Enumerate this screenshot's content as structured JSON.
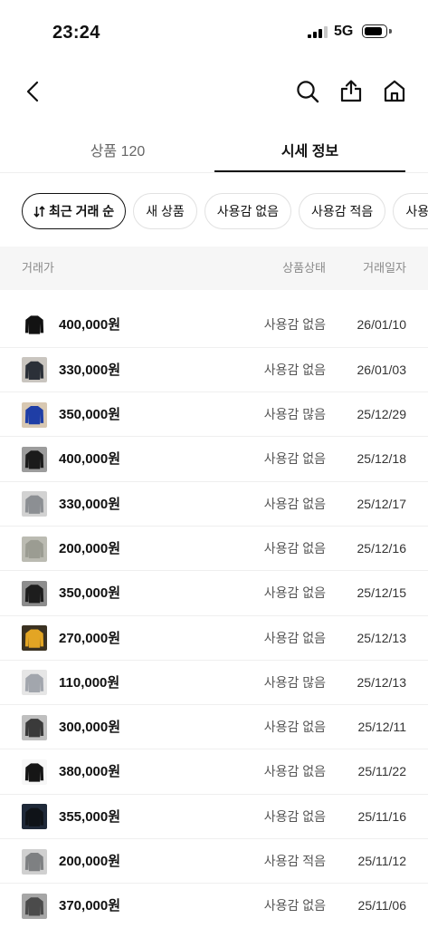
{
  "status_bar": {
    "time": "23:24",
    "network": "5G",
    "signal": {
      "filled": 3,
      "total": 4
    },
    "battery_percent": 85
  },
  "nav": {
    "back_icon": "chevron-left-icon",
    "search_icon": "search-icon",
    "share_icon": "share-icon",
    "home_icon": "home-icon"
  },
  "tabs": [
    {
      "label": "상품 120",
      "active": false
    },
    {
      "label": "시세 정보",
      "active": true
    }
  ],
  "filters": [
    {
      "label": "최근 거래 순",
      "icon": "sort-icon",
      "active": true
    },
    {
      "label": "새 상품",
      "active": false
    },
    {
      "label": "사용감 없음",
      "active": false
    },
    {
      "label": "사용감 적음",
      "active": false
    },
    {
      "label": "사용감",
      "active": false
    }
  ],
  "table": {
    "headers": {
      "price": "거래가",
      "condition": "상품상태",
      "date": "거래일자"
    },
    "rows": [
      {
        "price": "400,000원",
        "condition": "사용감 없음",
        "date": "26/01/10",
        "thumb": {
          "bg": "#ffffff",
          "item": "#121212"
        }
      },
      {
        "price": "330,000원",
        "condition": "사용감 없음",
        "date": "26/01/03",
        "thumb": {
          "bg": "#c9c5bf",
          "item": "#2b3038"
        }
      },
      {
        "price": "350,000원",
        "condition": "사용감 많음",
        "date": "25/12/29",
        "thumb": {
          "bg": "#d8c8b2",
          "item": "#1f3ea6"
        }
      },
      {
        "price": "400,000원",
        "condition": "사용감 없음",
        "date": "25/12/18",
        "thumb": {
          "bg": "#9c9c9c",
          "item": "#1b1b1b"
        }
      },
      {
        "price": "330,000원",
        "condition": "사용감 없음",
        "date": "25/12/17",
        "thumb": {
          "bg": "#d2d2d2",
          "item": "#8c8f93"
        }
      },
      {
        "price": "200,000원",
        "condition": "사용감 없음",
        "date": "25/12/16",
        "thumb": {
          "bg": "#bbbbb2",
          "item": "#9b9c92"
        }
      },
      {
        "price": "350,000원",
        "condition": "사용감 없음",
        "date": "25/12/15",
        "thumb": {
          "bg": "#8d8d8d",
          "item": "#1d1d1d"
        }
      },
      {
        "price": "270,000원",
        "condition": "사용감 없음",
        "date": "25/12/13",
        "thumb": {
          "bg": "#3b3222",
          "item": "#e3a524"
        }
      },
      {
        "price": "110,000원",
        "condition": "사용감 많음",
        "date": "25/12/13",
        "thumb": {
          "bg": "#e6e6e6",
          "item": "#a2a6ad"
        }
      },
      {
        "price": "300,000원",
        "condition": "사용감 없음",
        "date": "25/12/11",
        "thumb": {
          "bg": "#bfbfbf",
          "item": "#3a3a3a"
        }
      },
      {
        "price": "380,000원",
        "condition": "사용감 없음",
        "date": "25/11/22",
        "thumb": {
          "bg": "#f7f7f7",
          "item": "#161616"
        }
      },
      {
        "price": "355,000원",
        "condition": "사용감 없음",
        "date": "25/11/16",
        "thumb": {
          "bg": "#1f2939",
          "item": "#0f1318"
        }
      },
      {
        "price": "200,000원",
        "condition": "사용감 적음",
        "date": "25/11/12",
        "thumb": {
          "bg": "#d0d0d0",
          "item": "#7e8082"
        }
      },
      {
        "price": "370,000원",
        "condition": "사용감 없음",
        "date": "25/11/06",
        "thumb": {
          "bg": "#a6a6a6",
          "item": "#4b4b4b"
        }
      }
    ]
  },
  "colors": {
    "text-primary": "#111111",
    "text-secondary": "#8a8a8a",
    "text-condition": "#555555",
    "text-date": "#333333",
    "chip-border": "#e1e1e1",
    "header-bg": "#f6f6f6",
    "divider": "#efefef"
  }
}
